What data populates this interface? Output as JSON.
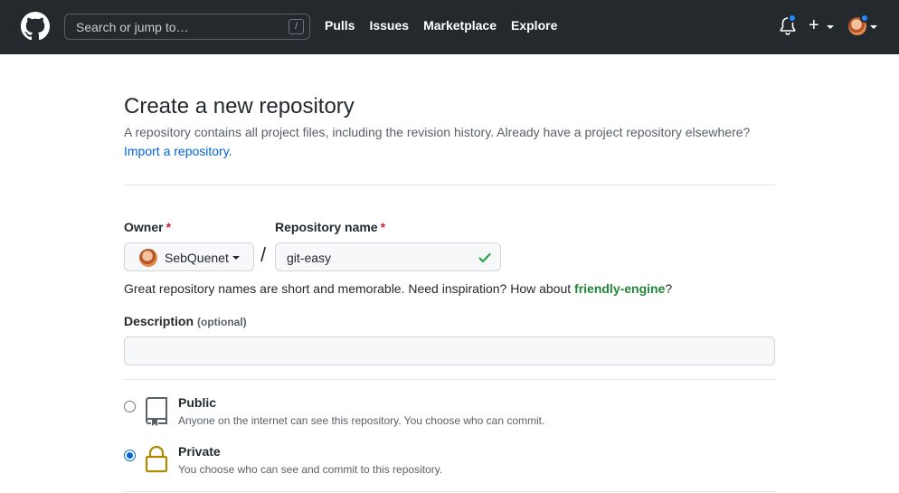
{
  "header": {
    "search_placeholder": "Search or jump to…",
    "search_shortcut": "/",
    "nav": [
      "Pulls",
      "Issues",
      "Marketplace",
      "Explore"
    ],
    "plus_label": "+"
  },
  "page": {
    "title": "Create a new repository",
    "subtitle": "A repository contains all project files, including the revision history. Already have a project repository elsewhere?",
    "import_link": "Import a repository."
  },
  "form": {
    "owner_label": "Owner",
    "owner_required": "*",
    "owner_value": "SebQuenet",
    "separator": "/",
    "repo_label": "Repository name",
    "repo_required": "*",
    "repo_value": "git-easy",
    "hint_prefix": "Great repository names are short and memorable. Need inspiration? How about ",
    "hint_suggestion": "friendly-engine",
    "hint_suffix": "?",
    "description_label": "Description",
    "description_optional": "(optional)",
    "description_value": ""
  },
  "visibility": {
    "selected": "private",
    "options": [
      {
        "id": "public",
        "title": "Public",
        "desc": "Anyone on the internet can see this repository. You choose who can commit.",
        "icon": "repo-icon"
      },
      {
        "id": "private",
        "title": "Private",
        "desc": "You choose who can see and commit to this repository.",
        "icon": "lock-icon"
      }
    ]
  },
  "colors": {
    "header_bg": "#24292e",
    "link": "#0366d6",
    "success": "#22863a",
    "required": "#cb2431",
    "notification": "#2188ff",
    "lock": "#b08800"
  }
}
